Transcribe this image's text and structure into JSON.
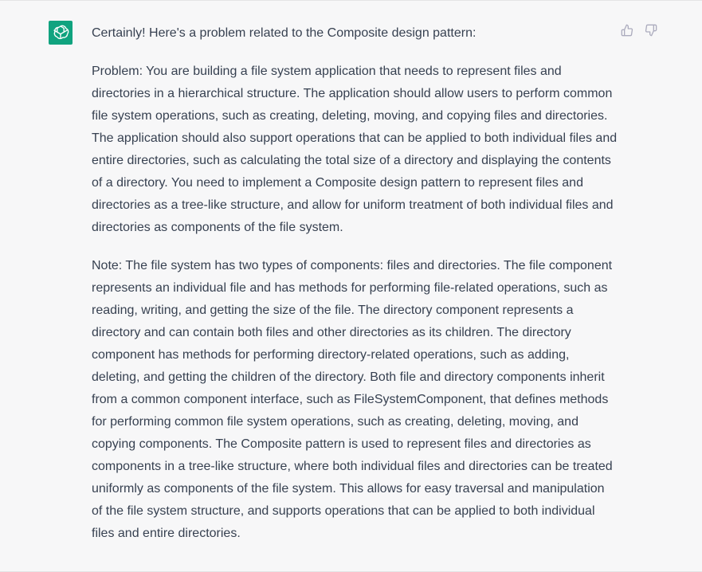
{
  "message": {
    "intro": "Certainly! Here's a problem related to the Composite design pattern:",
    "paragraphs": [
      "Problem: You are building a file system application that needs to represent files and directories in a hierarchical structure. The application should allow users to perform common file system operations, such as creating, deleting, moving, and copying files and directories. The application should also support operations that can be applied to both individual files and entire directories, such as calculating the total size of a directory and displaying the contents of a directory. You need to implement a Composite design pattern to represent files and directories as a tree-like structure, and allow for uniform treatment of both individual files and directories as components of the file system.",
      "Note: The file system has two types of components: files and directories. The file component represents an individual file and has methods for performing file-related operations, such as reading, writing, and getting the size of the file. The directory component represents a directory and can contain both files and other directories as its children. The directory component has methods for performing directory-related operations, such as adding, deleting, and getting the children of the directory. Both file and directory components inherit from a common component interface, such as FileSystemComponent, that defines methods for performing common file system operations, such as creating, deleting, moving, and copying components. The Composite pattern is used to represent files and directories as components in a tree-like structure, where both individual files and directories can be treated uniformly as components of the file system. This allows for easy traversal and manipulation of the file system structure, and supports operations that can be applied to both individual files and entire directories."
    ]
  },
  "icons": {
    "avatar": "openai-logo-icon",
    "thumbs_up": "thumbs-up-icon",
    "thumbs_down": "thumbs-down-icon"
  },
  "colors": {
    "avatar_bg": "#10a37f",
    "background": "#f7f7f8",
    "text": "#374151",
    "icon": "#acacbe"
  }
}
